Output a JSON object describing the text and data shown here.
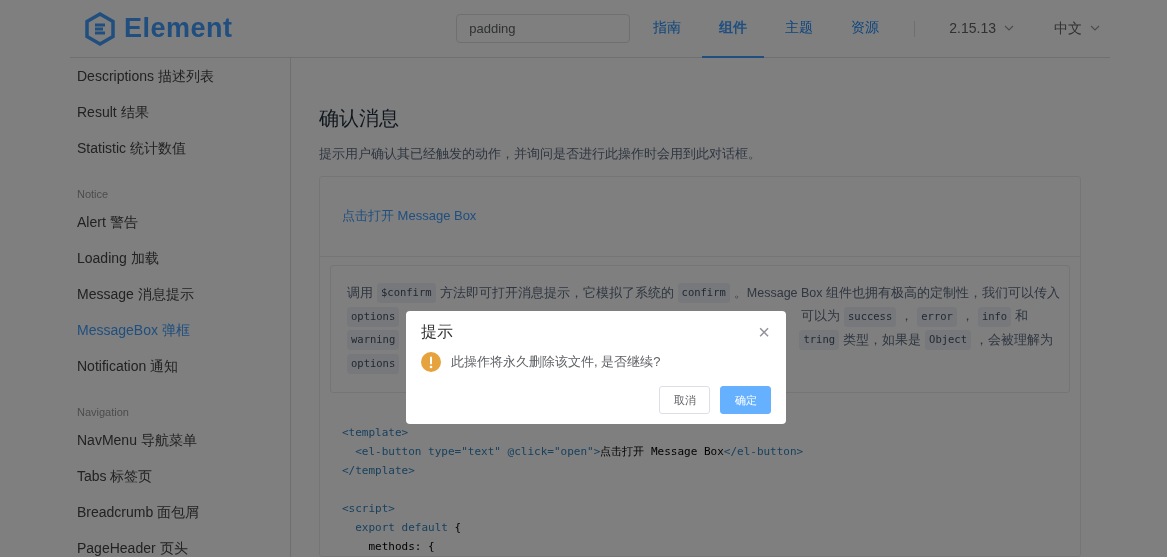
{
  "header": {
    "logo_text": "Element",
    "search": {
      "value": "padding"
    },
    "nav": [
      {
        "label": "指南",
        "selected": false
      },
      {
        "label": "组件",
        "selected": true
      },
      {
        "label": "主题",
        "selected": false
      },
      {
        "label": "资源",
        "selected": false
      }
    ],
    "version": "2.15.13",
    "language": "中文"
  },
  "sidebar": [
    {
      "kind": "item",
      "label": "Descriptions 描述列表",
      "selected": false
    },
    {
      "kind": "item",
      "label": "Result 结果",
      "selected": false
    },
    {
      "kind": "item",
      "label": "Statistic 统计数值",
      "selected": false
    },
    {
      "kind": "group",
      "label": "Notice"
    },
    {
      "kind": "item",
      "label": "Alert 警告",
      "selected": false
    },
    {
      "kind": "item",
      "label": "Loading 加载",
      "selected": false
    },
    {
      "kind": "item",
      "label": "Message 消息提示",
      "selected": false
    },
    {
      "kind": "item",
      "label": "MessageBox 弹框",
      "selected": true
    },
    {
      "kind": "item",
      "label": "Notification 通知",
      "selected": false
    },
    {
      "kind": "group",
      "label": "Navigation"
    },
    {
      "kind": "item",
      "label": "NavMenu 导航菜单",
      "selected": false
    },
    {
      "kind": "item",
      "label": "Tabs 标签页",
      "selected": false
    },
    {
      "kind": "item",
      "label": "Breadcrumb 面包屑",
      "selected": false
    },
    {
      "kind": "item",
      "label": "PageHeader 页头",
      "selected": false
    }
  ],
  "main": {
    "title": "确认消息",
    "description": "提示用户确认其已经触发的动作，并询问是否进行此操作时会用到此对话框。",
    "demo_link": "点击打开 Message Box",
    "doc_lines": [
      {
        "left": [
          {
            "kind": "text",
            "text": "调用"
          },
          {
            "kind": "code",
            "text": "$confirm"
          },
          {
            "kind": "text",
            "text": "方法即可打开消息提示，它模拟了系统的"
          },
          {
            "kind": "code",
            "text": "confirm"
          },
          {
            "kind": "text",
            "text": "。Message Box 组件也拥有极高的定制性，我们可以传入"
          }
        ]
      },
      {
        "left": [
          {
            "kind": "code",
            "text": "options"
          }
        ],
        "right": [
          {
            "kind": "text",
            "text": "可以为"
          },
          {
            "kind": "code",
            "text": "success"
          },
          {
            "kind": "text",
            "text": "，"
          },
          {
            "kind": "code",
            "text": "error"
          },
          {
            "kind": "text",
            "text": "，"
          },
          {
            "kind": "code",
            "text": "info"
          },
          {
            "kind": "text",
            "text": "和"
          }
        ]
      },
      {
        "left": [
          {
            "kind": "code",
            "text": "warning"
          }
        ],
        "right": [
          {
            "kind": "code",
            "text": "tring"
          },
          {
            "kind": "text",
            "text": "类型，如果是"
          },
          {
            "kind": "code",
            "text": "Object"
          },
          {
            "kind": "text",
            "text": "，会被理解为"
          }
        ]
      },
      {
        "left": [
          {
            "kind": "code",
            "text": "options"
          }
        ]
      }
    ],
    "code_lines": [
      {
        "kind": "code",
        "parts": [
          {
            "kind": "tag",
            "text": "<template>"
          }
        ],
        "children": [
          {
            "kind": "code",
            "parts": [
              {
                "kind": "tag",
                "text": "<el-button type=\"text\" @click=\"open\">"
              },
              {
                "kind": "plain",
                "text": "点击打开 Message Box"
              },
              {
                "kind": "tag",
                "text": "</el-button>"
              }
            ]
          }
        ]
      },
      {
        "kind": "code",
        "parts": [
          {
            "kind": "tag",
            "text": "</template>"
          }
        ]
      },
      {
        "kind": "blank"
      },
      {
        "kind": "code",
        "parts": [
          {
            "kind": "tag",
            "text": "<script>"
          }
        ],
        "children": [
          {
            "kind": "code",
            "parts": [
              {
                "kind": "tag",
                "text": "export default"
              },
              {
                "kind": "plain",
                "text": " {"
              }
            ],
            "children": [
              {
                "kind": "code",
                "parts": [
                  {
                    "kind": "plain",
                    "text": "methods: {"
                  }
                ]
              }
            ]
          }
        ]
      }
    ]
  },
  "dialog": {
    "title": "提示",
    "close": "×",
    "message": "此操作将永久删除该文件, 是否继续?",
    "buttons": [
      {
        "kind": "default",
        "label": "取消"
      },
      {
        "kind": "primary",
        "label": "确定"
      }
    ]
  }
}
